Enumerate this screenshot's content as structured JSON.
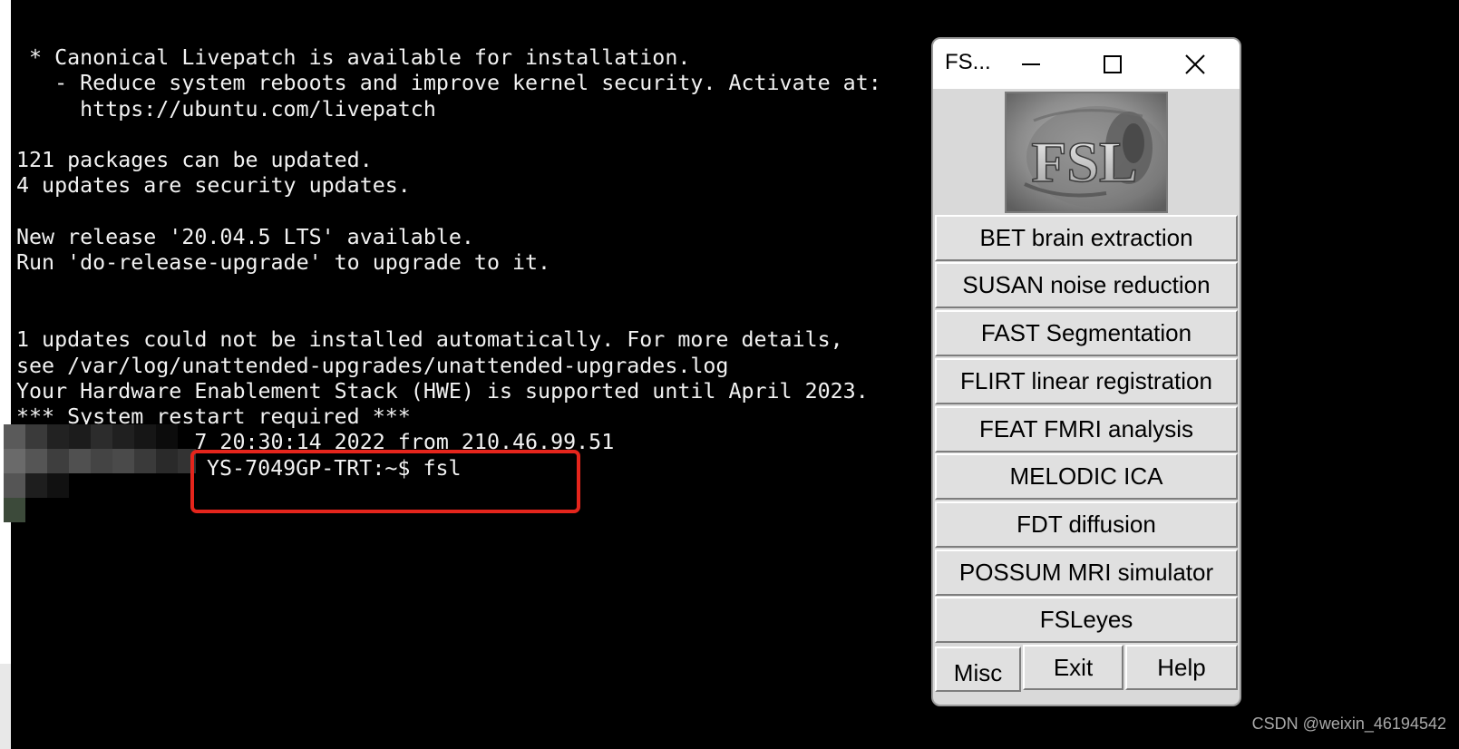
{
  "terminal": {
    "lines": [
      " * Canonical Livepatch is available for installation.",
      "   - Reduce system reboots and improve kernel security. Activate at:",
      "     https://ubuntu.com/livepatch",
      "",
      "121 packages can be updated.",
      "4 updates are security updates.",
      "",
      "New release '20.04.5 LTS' available.",
      "Run 'do-release-upgrade' to upgrade to it.",
      "",
      "",
      "1 updates could not be installed automatically. For more details,",
      "see /var/log/unattended-upgrades/unattended-upgrades.log",
      "Your Hardware Enablement Stack (HWE) is supported until April 2023.",
      "*** System restart required ***",
      "       i Oct  7 20:30:14 2022 from 210.46.99.51"
    ],
    "prompt": "YS-7049GP-TRT:~$ fsl"
  },
  "fsl_window": {
    "title": "FS...",
    "minimize_icon": "minimize-icon",
    "maximize_icon": "maximize-icon",
    "close_icon": "close-icon",
    "logo_text": "FSL",
    "tools": [
      "BET brain extraction",
      "SUSAN noise reduction",
      "FAST Segmentation",
      "FLIRT linear registration",
      "FEAT FMRI analysis",
      "MELODIC ICA",
      "FDT diffusion",
      "POSSUM MRI simulator",
      "FSLeyes"
    ],
    "bottom": {
      "misc": "Misc",
      "exit": "Exit",
      "help": "Help"
    }
  },
  "watermark": "CSDN @weixin_46194542",
  "colors": {
    "terminal_bg": "#000000",
    "terminal_fg": "#f2f2f2",
    "highlight": "#e5251c",
    "window_bg": "#d9d9d9"
  }
}
